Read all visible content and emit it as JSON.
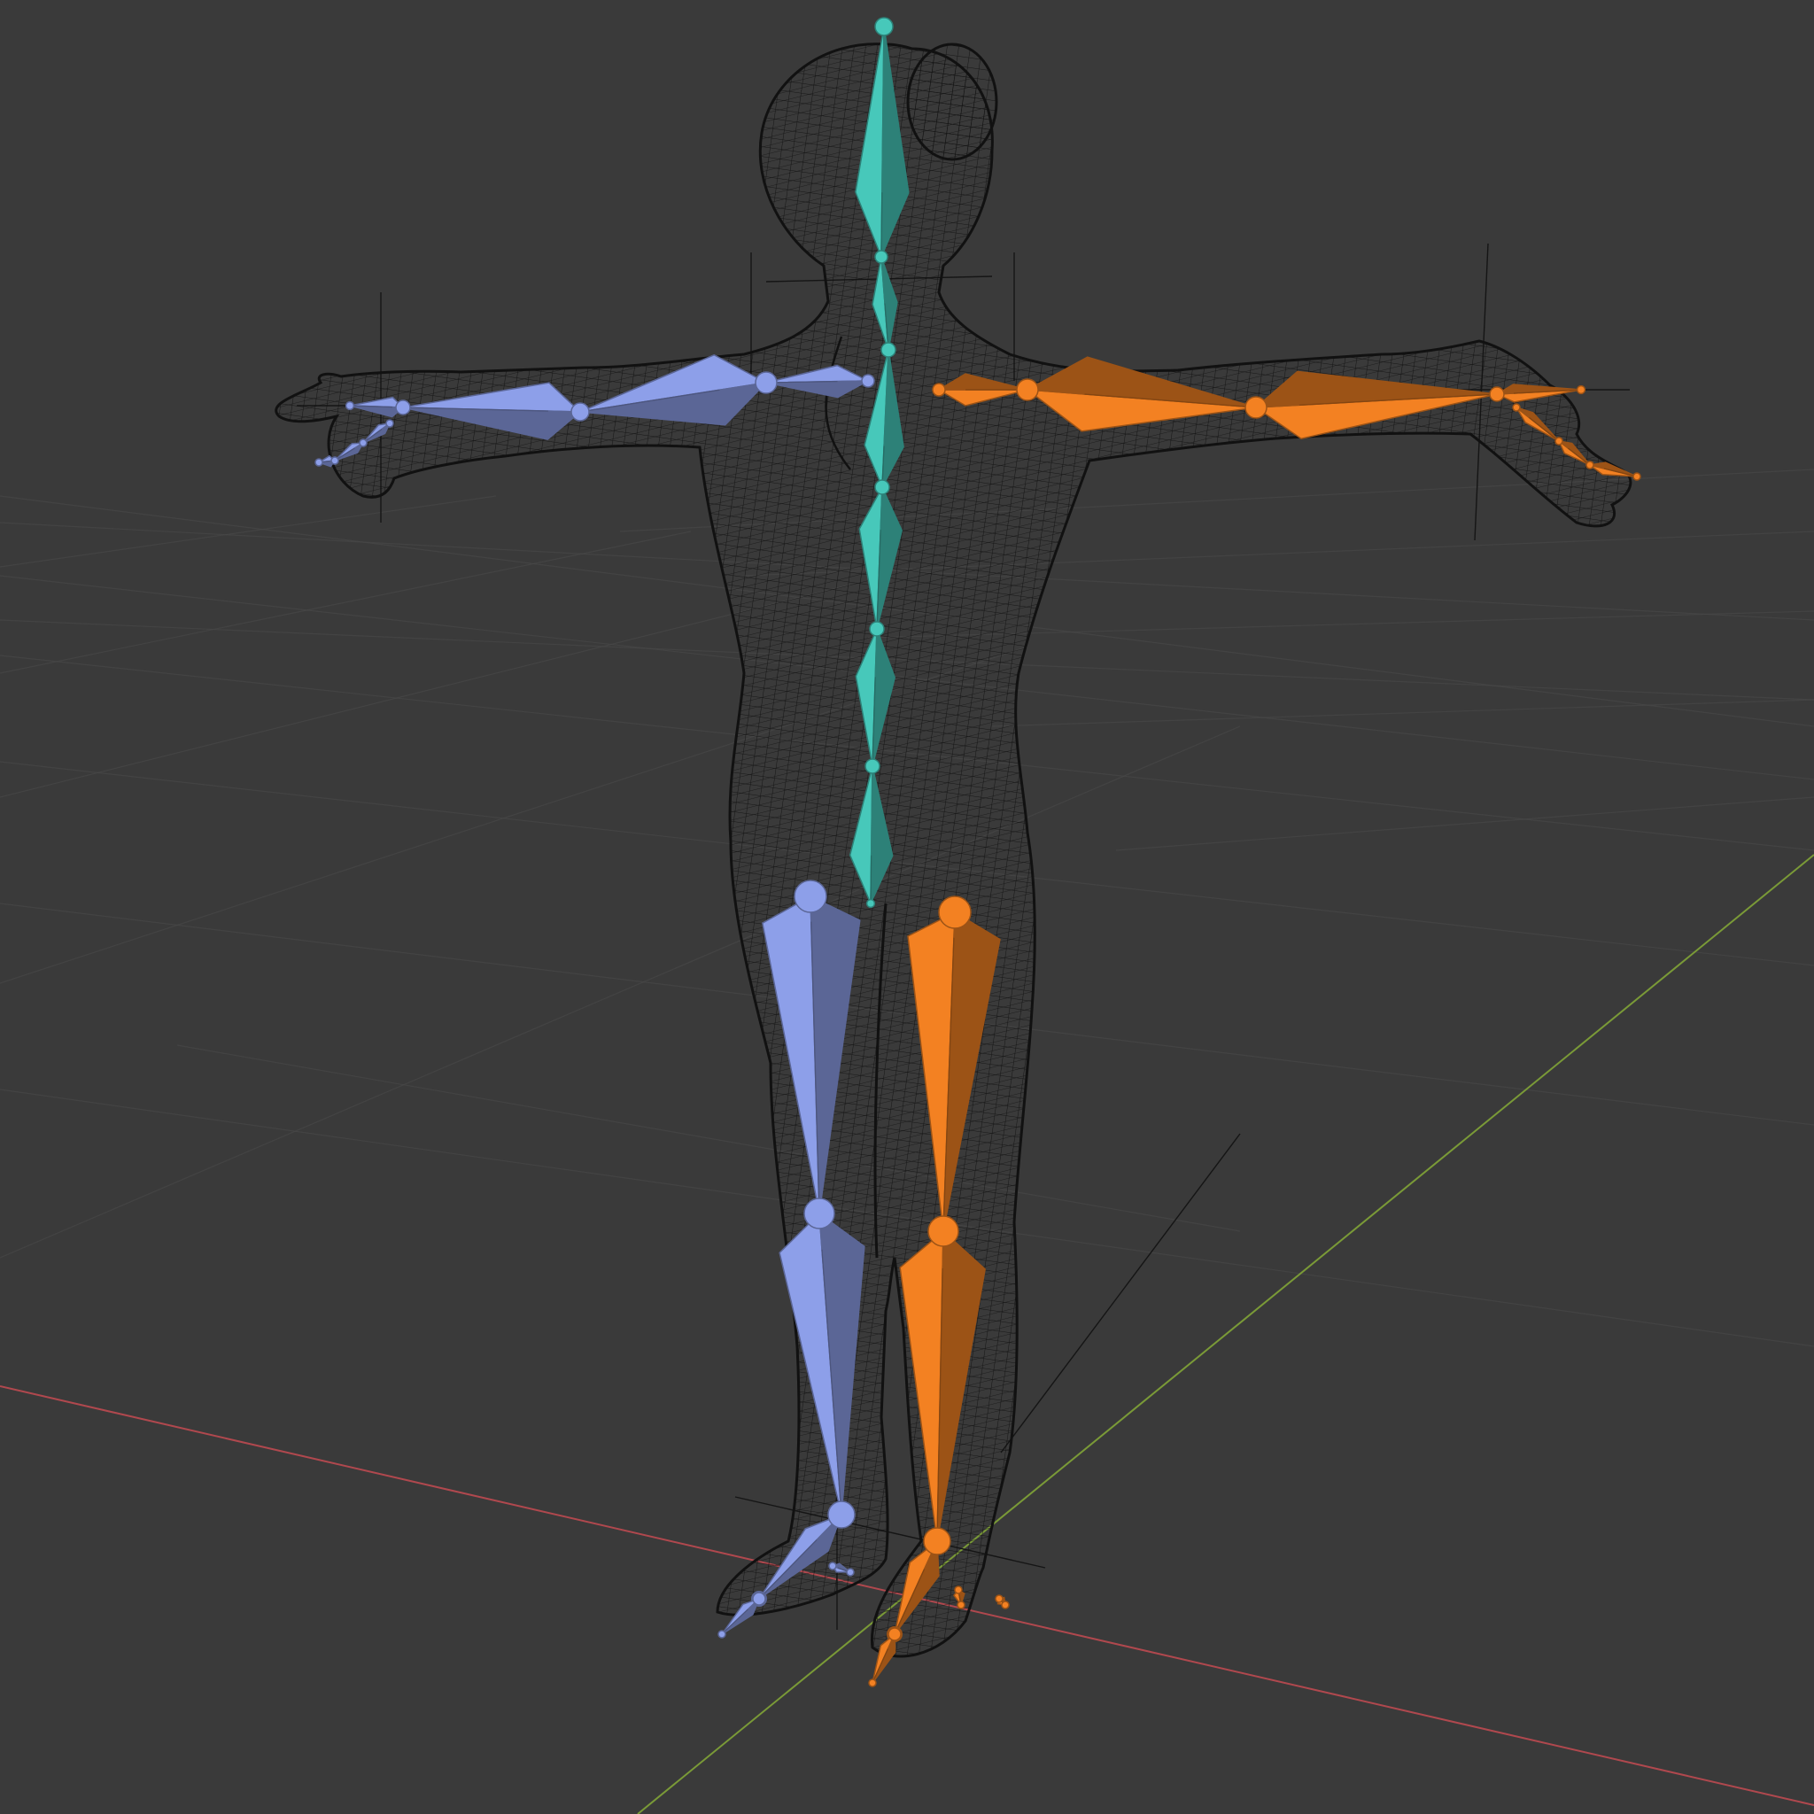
{
  "viewport": {
    "kind": "3d-viewport",
    "shading": "wireframe",
    "background_color": "#3a3a3a",
    "grid_color": "#474747",
    "x_axis_color": "#b0484e",
    "y_axis_color": "#7a9a37"
  },
  "mesh": {
    "name": "humanoid-mesh",
    "wire_color": "#111111"
  },
  "armature": {
    "center_color": "#3fb3a6",
    "left_color": "#7e8ed0",
    "right_color": "#d9731e",
    "bones": {
      "center": [
        "head",
        "neck",
        "spine-upper",
        "spine-mid",
        "spine-lower",
        "pelvis"
      ],
      "left": [
        "left-clavicle",
        "left-upper-arm",
        "left-forearm",
        "left-hand",
        "left-thigh",
        "left-shin",
        "left-foot",
        "left-toe"
      ],
      "right": [
        "right-clavicle",
        "right-upper-arm",
        "right-forearm",
        "right-hand",
        "right-thigh",
        "right-shin",
        "right-foot",
        "right-toe"
      ]
    }
  }
}
